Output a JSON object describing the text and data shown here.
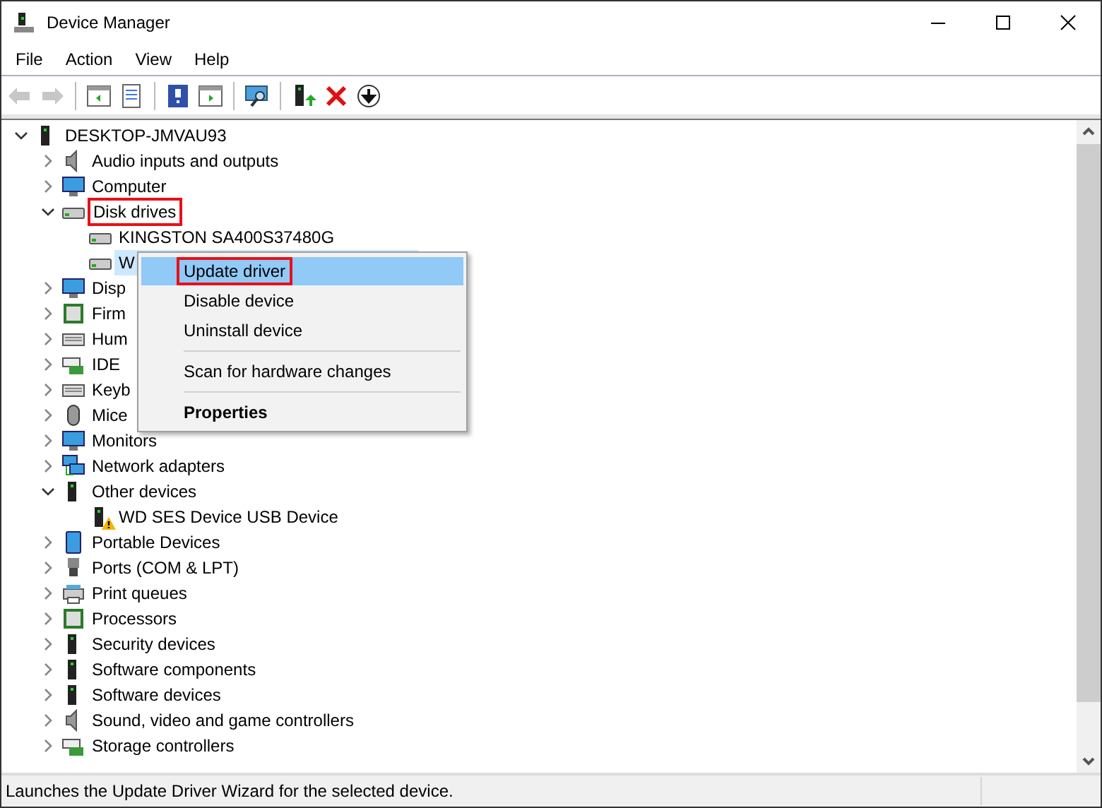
{
  "window": {
    "title": "Device Manager"
  },
  "menu": [
    "File",
    "Action",
    "View",
    "Help"
  ],
  "toolbar": [
    {
      "disabled": true
    },
    {
      "disabled": true
    },
    {
      "disabled": false
    },
    {
      "disabled": false
    },
    {
      "disabled": false
    },
    {
      "disabled": false
    },
    {
      "disabled": false
    },
    {
      "disabled": false
    },
    {
      "disabled": false
    },
    {
      "disabled": false
    }
  ],
  "tree": [
    {
      "label": "DESKTOP-JMVAU93",
      "expanded": true,
      "children": [
        {
          "label": "Audio inputs and outputs",
          "expanded": false
        },
        {
          "label": "Computer",
          "expanded": false
        },
        {
          "label": "Disk drives",
          "expanded": true,
          "outlined": true,
          "children": [
            {
              "label": "KINGSTON SA400S37480G",
              "selected": false
            },
            {
              "label": "W",
              "selected": true
            }
          ]
        },
        {
          "label": "Disp",
          "expanded": false
        },
        {
          "label": "Firm",
          "expanded": false
        },
        {
          "label": "Hum",
          "expanded": false
        },
        {
          "label": "IDE",
          "expanded": false
        },
        {
          "label": "Keyb",
          "expanded": false
        },
        {
          "label": "Mice",
          "expanded": false
        },
        {
          "label": "Monitors",
          "expanded": false
        },
        {
          "label": "Network adapters",
          "expanded": false
        },
        {
          "label": "Other devices",
          "expanded": true,
          "children": [
            {
              "label": "WD SES Device USB Device",
              "selected": false,
              "warning": true
            }
          ]
        },
        {
          "label": "Portable Devices",
          "expanded": false
        },
        {
          "label": "Ports (COM & LPT)",
          "expanded": false
        },
        {
          "label": "Print queues",
          "expanded": false
        },
        {
          "label": "Processors",
          "expanded": false
        },
        {
          "label": "Security devices",
          "expanded": false
        },
        {
          "label": "Software components",
          "expanded": false
        },
        {
          "label": "Software devices",
          "expanded": false
        },
        {
          "label": "Sound, video and game controllers",
          "expanded": false
        },
        {
          "label": "Storage controllers",
          "expanded": false
        }
      ]
    }
  ],
  "context_menu": [
    {
      "kind": "item",
      "label": "Update driver",
      "selected": true,
      "outlined": true,
      "default": false
    },
    {
      "kind": "item",
      "label": "Disable device",
      "selected": false,
      "outlined": false,
      "default": false
    },
    {
      "kind": "item",
      "label": "Uninstall device",
      "selected": false,
      "outlined": false,
      "default": false
    },
    {
      "kind": "separator"
    },
    {
      "kind": "item",
      "label": "Scan for hardware changes",
      "selected": false,
      "outlined": false,
      "default": false
    },
    {
      "kind": "separator"
    },
    {
      "kind": "item",
      "label": "Properties",
      "selected": false,
      "outlined": false,
      "default": true
    }
  ],
  "status_bar": "Launches the Update Driver Wizard for the selected device."
}
